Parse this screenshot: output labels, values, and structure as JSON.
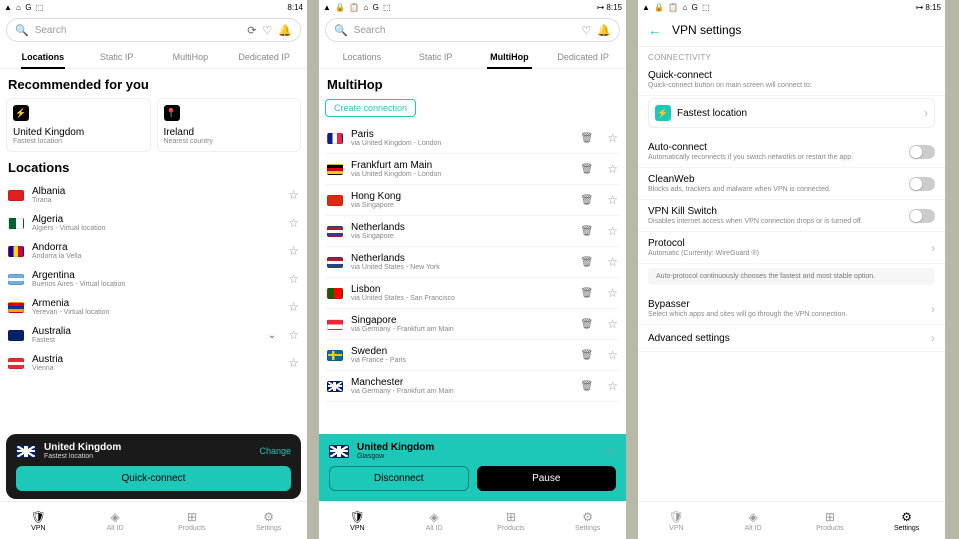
{
  "screen1": {
    "status": {
      "icons": "▲ ⌂ G ⬚",
      "time": "8:14"
    },
    "search": {
      "placeholder": "Search"
    },
    "tabs": [
      "Locations",
      "Static IP",
      "MultiHop",
      "Dedicated IP"
    ],
    "active_tab": 0,
    "recommended_heading": "Recommended for you",
    "recommended": [
      {
        "icon": "⚡",
        "title": "United Kingdom",
        "sub": "Fastest location"
      },
      {
        "icon": "📍",
        "title": "Ireland",
        "sub": "Nearest country"
      }
    ],
    "locations_heading": "Locations",
    "locations": [
      {
        "flag": "fl-al",
        "name": "Albania",
        "sub": "Tirana"
      },
      {
        "flag": "fl-dz",
        "name": "Algeria",
        "sub": "Algiers - Virtual location"
      },
      {
        "flag": "fl-ad",
        "name": "Andorra",
        "sub": "Andorra la Vella"
      },
      {
        "flag": "fl-ar",
        "name": "Argentina",
        "sub": "Buenos Aires - Virtual location"
      },
      {
        "flag": "fl-am",
        "name": "Armenia",
        "sub": "Yerevan - Virtual location"
      },
      {
        "flag": "fl-au",
        "name": "Australia",
        "sub": "Fastest",
        "expandable": true
      },
      {
        "flag": "fl-at",
        "name": "Austria",
        "sub": "Vienna"
      }
    ],
    "conn": {
      "flag": "fl-gb",
      "name": "United Kingdom",
      "sub": "Fastest location",
      "change": "Change",
      "button": "Quick-connect"
    },
    "nav": [
      {
        "icon": "🛡",
        "label": "VPN"
      },
      {
        "icon": "◈",
        "label": "Alt ID"
      },
      {
        "icon": "⊞",
        "label": "Products"
      },
      {
        "icon": "⚙",
        "label": "Settings"
      }
    ],
    "nav_active": 0
  },
  "screen2": {
    "status": {
      "icons": "▲ 🔒 📋 ⌂ G ⬚",
      "right": "⊶",
      "time": "8:15"
    },
    "search": {
      "placeholder": "Search"
    },
    "tabs": [
      "Locations",
      "Static IP",
      "MultiHop",
      "Dedicated IP"
    ],
    "active_tab": 2,
    "heading": "MultiHop",
    "create": "Create connection",
    "routes": [
      {
        "flag": "fl-fr",
        "name": "Paris",
        "sub": "via United Kingdom - London"
      },
      {
        "flag": "fl-de",
        "name": "Frankfurt am Main",
        "sub": "via United Kingdom - London"
      },
      {
        "flag": "fl-hk",
        "name": "Hong Kong",
        "sub": "via Singapore"
      },
      {
        "flag": "fl-nl",
        "name": "Netherlands",
        "sub": "via Singapore"
      },
      {
        "flag": "fl-nl",
        "name": "Netherlands",
        "sub": "via United States - New York"
      },
      {
        "flag": "fl-pt",
        "name": "Lisbon",
        "sub": "via United States - San Francisco"
      },
      {
        "flag": "fl-sg",
        "name": "Singapore",
        "sub": "via Germany - Frankfurt am Main"
      },
      {
        "flag": "fl-se",
        "name": "Sweden",
        "sub": "via France - Paris"
      },
      {
        "flag": "fl-gb",
        "name": "Manchester",
        "sub": "via Germany - Frankfurt am Main"
      }
    ],
    "conn": {
      "flag": "fl-gb",
      "name": "United Kingdom",
      "sub": "Glasgow",
      "disconnect": "Disconnect",
      "pause": "Pause"
    },
    "nav_active": 0
  },
  "screen3": {
    "status": {
      "icons": "▲ 🔒 📋 ⌂ G ⬚",
      "right": "⊶",
      "time": "8:15"
    },
    "title": "VPN settings",
    "section": "Connectivity",
    "quick_connect": {
      "title": "Quick-connect",
      "sub": "Quick-connect button on main screen will connect to:"
    },
    "fastest": "Fastest location",
    "auto_connect": {
      "title": "Auto-connect",
      "sub": "Automatically reconnects if you switch networks or restart the app."
    },
    "cleanweb": {
      "title": "CleanWeb",
      "sub": "Blocks ads, trackers and malware when VPN is connected."
    },
    "killswitch": {
      "title": "VPN Kill Switch",
      "sub": "Disables internet access when VPN connection drops or is turned off."
    },
    "protocol": {
      "title": "Protocol",
      "sub": "Automatic (Currently: WireGuard ®)"
    },
    "protocol_note": "Auto-protocol continuously chooses the fastest and most stable option.",
    "bypasser": {
      "title": "Bypasser",
      "sub": "Select which apps and sites will go through the VPN connection."
    },
    "advanced": "Advanced settings",
    "nav_active": 3
  }
}
